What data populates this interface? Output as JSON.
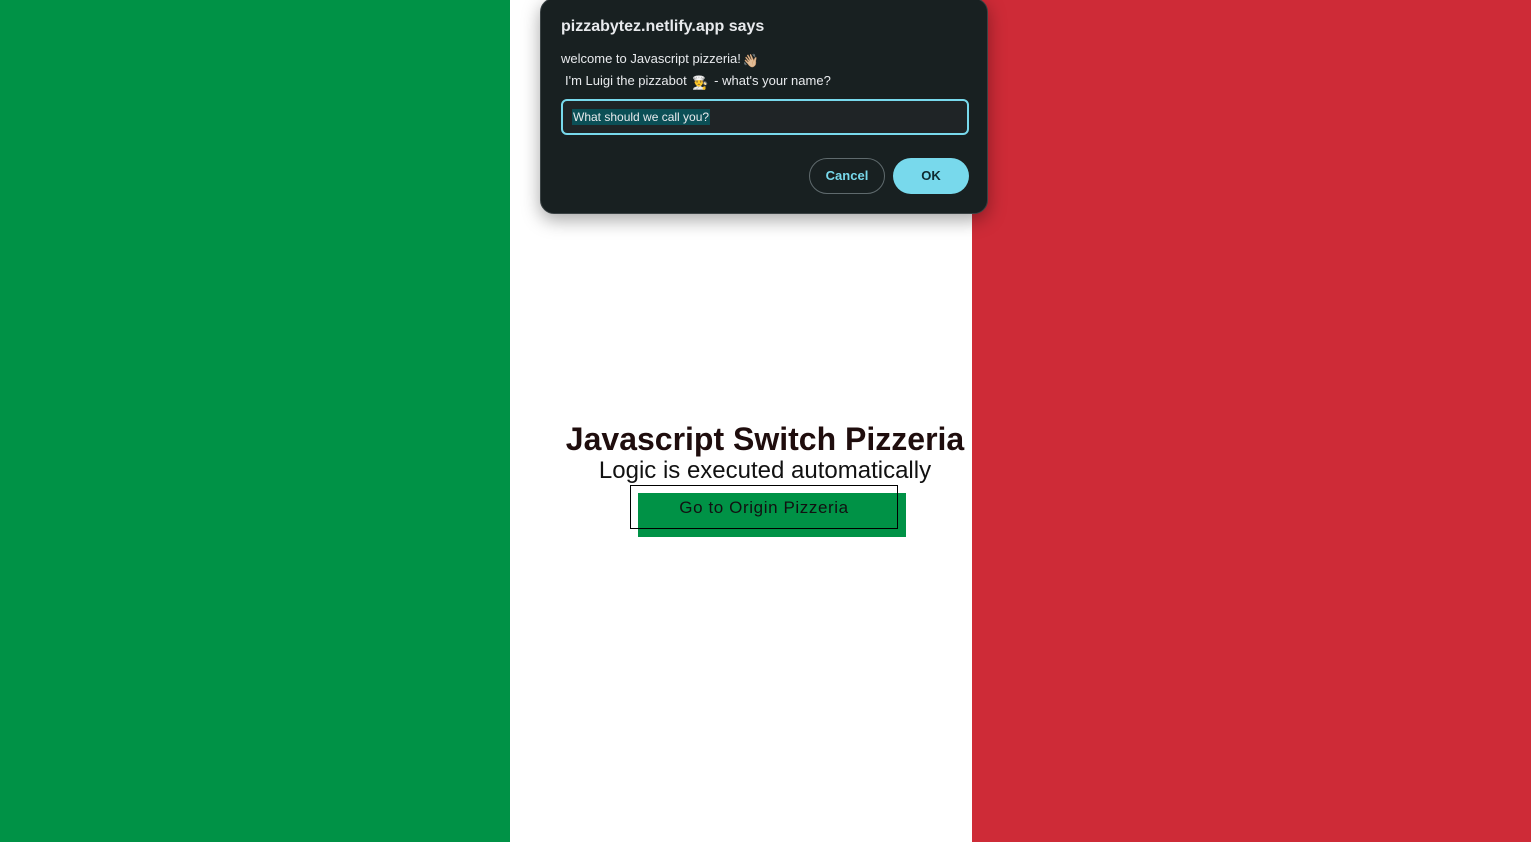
{
  "colors": {
    "flag_green": "#009246",
    "flag_white": "#ffffff",
    "flag_red": "#ce2b37",
    "dialog_bg": "#182021",
    "accent": "#78d9ec",
    "button_green": "#009246"
  },
  "page": {
    "title": "Javascript Switch Pizzeria",
    "subtitle": "Logic is executed automatically",
    "origin_button_label": "Go to Origin Pizzeria"
  },
  "dialog": {
    "title": "pizzabytez.netlify.app says",
    "line1": "welcome to Javascript pizzeria!",
    "line1_emoji": "👋🏼",
    "line2_prefix": "I'm Luigi the pizzabot",
    "line2_emoji": "👨‍🍳",
    "line2_suffix": "- what's your name?",
    "input_value": "What should we call you?",
    "cancel_label": "Cancel",
    "ok_label": "OK"
  }
}
